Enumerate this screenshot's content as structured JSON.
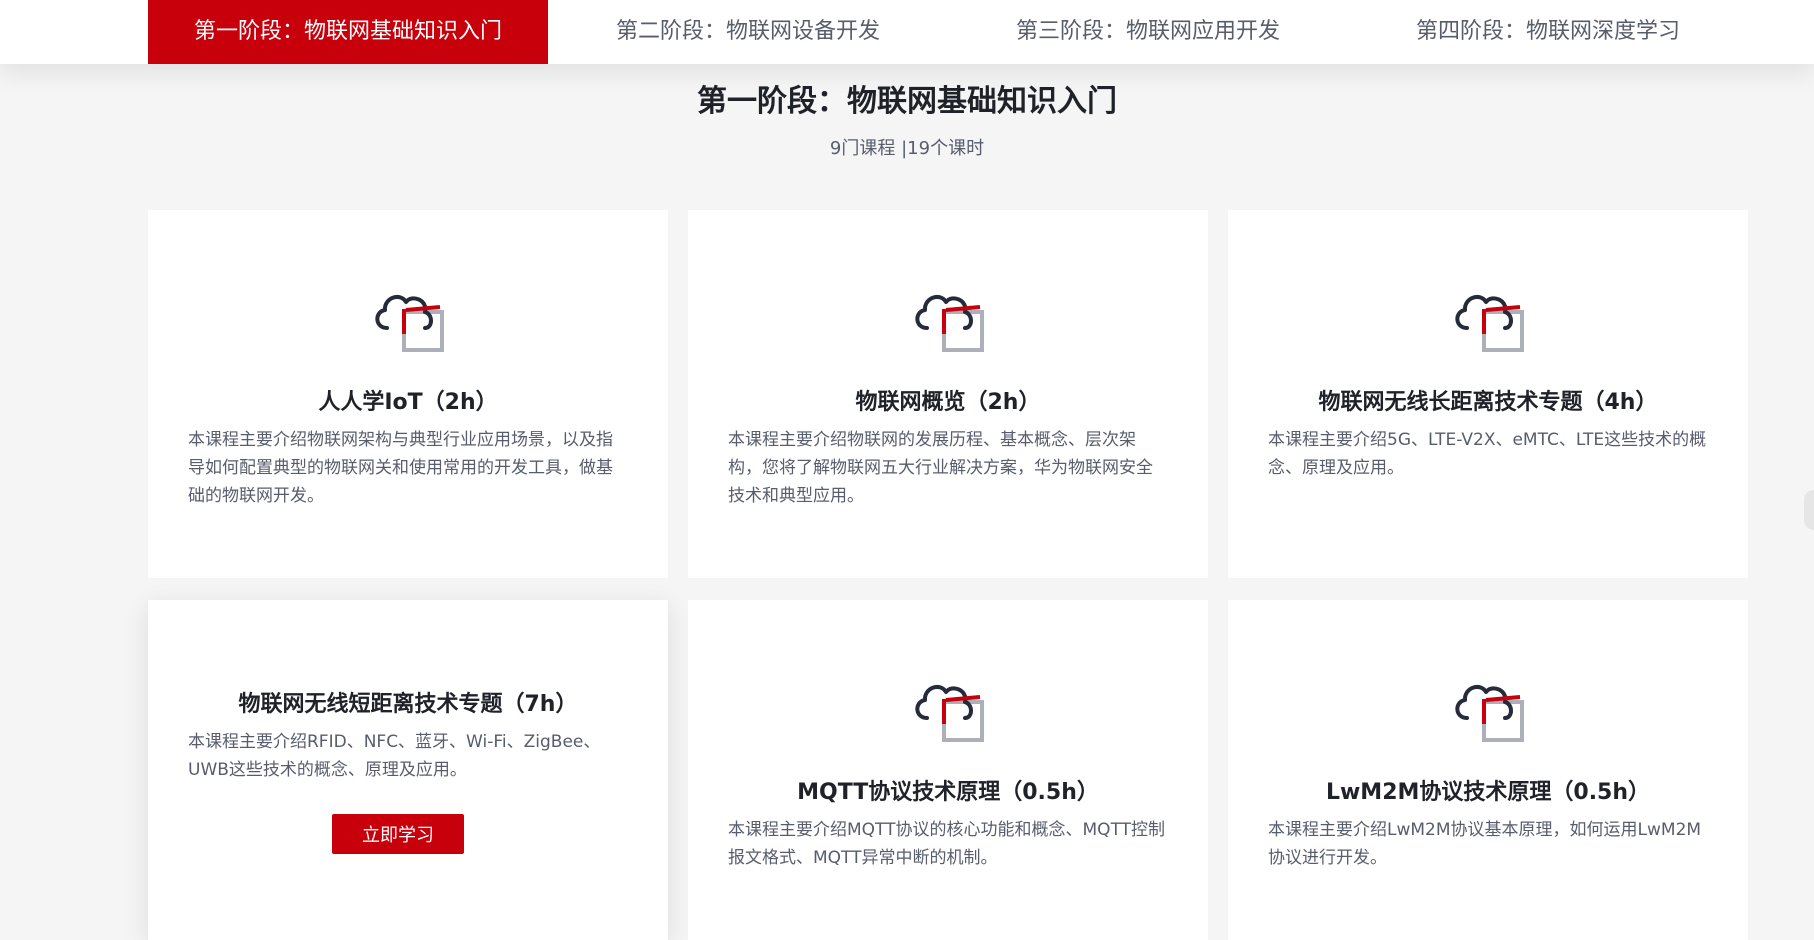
{
  "tabs": [
    {
      "label": "第一阶段：物联网基础知识入门",
      "active": true
    },
    {
      "label": "第二阶段：物联网设备开发",
      "active": false
    },
    {
      "label": "第三阶段：物联网应用开发",
      "active": false
    },
    {
      "label": "第四阶段：物联网深度学习",
      "active": false
    }
  ],
  "section": {
    "title": "第一阶段：物联网基础知识入门",
    "meta": "9门课程 |19个课时"
  },
  "courses": [
    {
      "title": "人人学IoT（2h）",
      "desc": "本课程主要介绍物联网架构与典型行业应用场景，以及指导如何配置典型的物联网关和使用常用的开发工具，做基础的物联网开发。"
    },
    {
      "title": "物联网概览（2h）",
      "desc": "本课程主要介绍物联网的发展历程、基本概念、层次架构，您将了解物联网五大行业解决方案，华为物联网安全技术和典型应用。"
    },
    {
      "title": "物联网无线长距离技术专题（4h）",
      "desc": "本课程主要介绍5G、LTE-V2X、eMTC、LTE这些技术的概念、原理及应用。"
    },
    {
      "title": "物联网无线短距离技术专题（7h）",
      "desc": "本课程主要介绍RFID、NFC、蓝牙、Wi-Fi、ZigBee、UWB这些技术的概念、原理及应用。",
      "button": "立即学习"
    },
    {
      "title": "MQTT协议技术原理（0.5h）",
      "desc": "本课程主要介绍MQTT协议的核心功能和概念、MQTT控制报文格式、MQTT异常中断的机制。"
    },
    {
      "title": "LwM2M协议技术原理（0.5h）",
      "desc": "本课程主要介绍LwM2M协议基本原理，如何运用LwM2M协议进行开发。"
    }
  ],
  "colors": {
    "accent": "#c7000b",
    "icon_dark": "#252b3a",
    "icon_gray": "#adb0b8"
  }
}
